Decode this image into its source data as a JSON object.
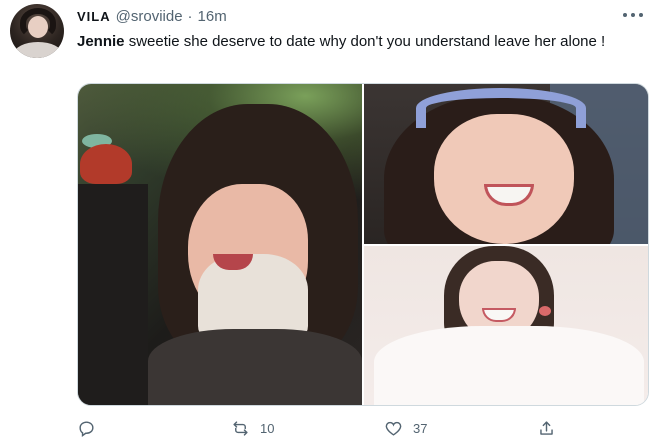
{
  "tweet": {
    "author": {
      "name": "VILA",
      "handle": "@sroviide",
      "separator": "·",
      "time": "16m"
    },
    "text": {
      "mention": "Jennie",
      "body": " sweetie she deserve to date why don't you understand leave her alone !"
    },
    "media": {
      "images": [
        {
          "icon": "photo-jennie-smiling-turtleneck"
        },
        {
          "icon": "photo-jennie-headband-smile"
        },
        {
          "icon": "photo-jennie-white-top-smile"
        }
      ]
    },
    "actions": {
      "reply": {
        "icon": "reply-icon",
        "count": ""
      },
      "retweet": {
        "icon": "retweet-icon",
        "count": "10"
      },
      "like": {
        "icon": "heart-icon",
        "count": "37"
      },
      "share": {
        "icon": "share-icon",
        "count": ""
      }
    }
  },
  "colors": {
    "text": "#0f1419",
    "secondary": "#536471",
    "border": "#cfd9de"
  }
}
